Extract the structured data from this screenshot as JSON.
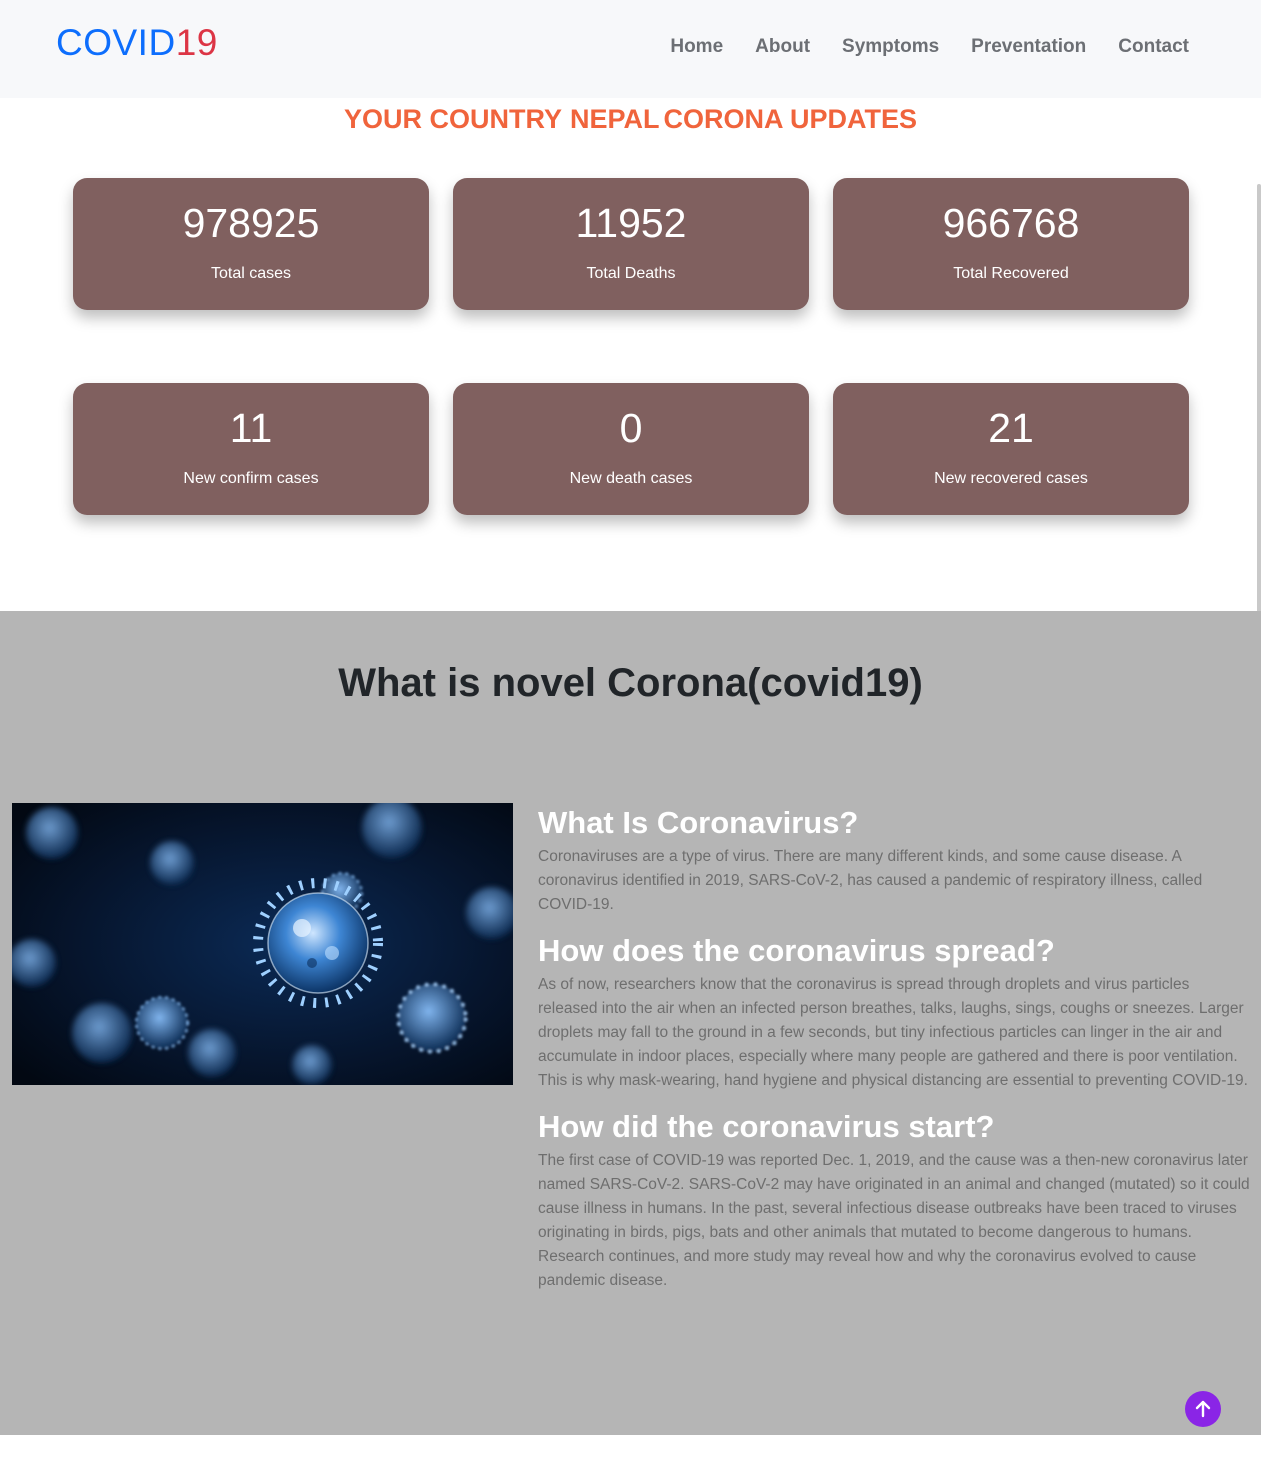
{
  "brand": {
    "part1": "COVID",
    "part2": "19"
  },
  "nav": {
    "home": "Home",
    "about": "About",
    "symptoms": "Symptoms",
    "preventation": "Preventation",
    "contact": "Contact"
  },
  "headline": {
    "prefix": "YOUR COUNTRY",
    "country": "NEPAL",
    "suffix": "CORONA UPDATES"
  },
  "stats": [
    {
      "value": "978925",
      "label": "Total cases"
    },
    {
      "value": "11952",
      "label": "Total Deaths"
    },
    {
      "value": "966768",
      "label": "Total Recovered"
    },
    {
      "value": "11",
      "label": "New confirm cases"
    },
    {
      "value": "0",
      "label": "New death cases"
    },
    {
      "value": "21",
      "label": "New recovered cases"
    }
  ],
  "about": {
    "title": "What is novel Corona(covid19)",
    "sections": [
      {
        "heading": "What Is Coronavirus?",
        "text": "Coronaviruses are a type of virus. There are many different kinds, and some cause disease. A coronavirus identified in 2019, SARS-CoV-2, has caused a pandemic of respiratory illness, called COVID-19."
      },
      {
        "heading": "How does the coronavirus spread?",
        "text": "As of now, researchers know that the coronavirus is spread through droplets and virus particles released into the air when an infected person breathes, talks, laughs, sings, coughs or sneezes. Larger droplets may fall to the ground in a few seconds, but tiny infectious particles can linger in the air and accumulate in indoor places, especially where many people are gathered and there is poor ventilation. This is why mask-wearing, hand hygiene and physical distancing are essential to preventing COVID-19."
      },
      {
        "heading": "How did the coronavirus start?",
        "text": "The first case of COVID-19 was reported Dec. 1, 2019, and the cause was a then-new coronavirus later named SARS-CoV-2. SARS-CoV-2 may have originated in an animal and changed (mutated) so it could cause illness in humans. In the past, several infectious disease outbreaks have been traced to viruses originating in birds, pigs, bats and other animals that mutated to become dangerous to humans. Research continues, and more study may reveal how and why the coronavirus evolved to cause pandemic disease."
      }
    ]
  },
  "colors": {
    "brand_blue": "#0d6efd",
    "brand_red": "#dc3545",
    "headline": "#f0643c",
    "card": "#80605f",
    "section_bg": "#b5b5b5",
    "top_button": "#8a25e6"
  },
  "icons": {
    "image": "coronavirus-image",
    "top_button": "arrow-up-icon"
  }
}
